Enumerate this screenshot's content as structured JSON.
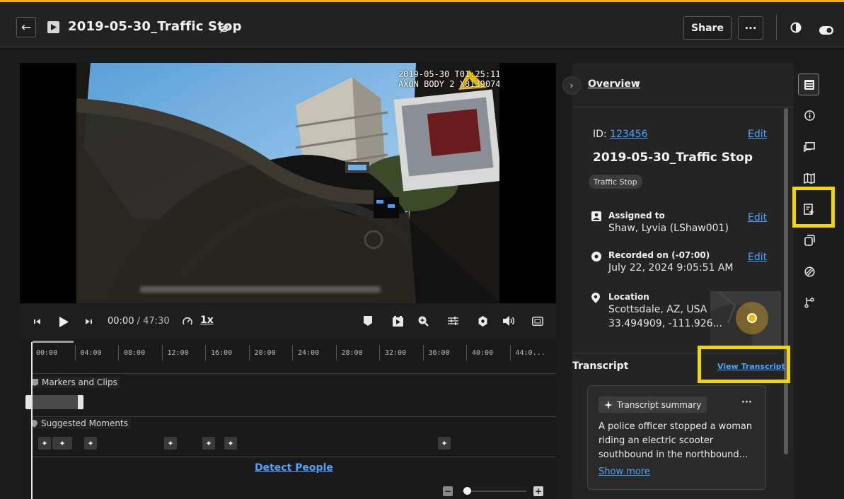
{
  "header": {
    "back_label": "←",
    "title": "2019-05-30_Traffic Stop",
    "share_label": "Share",
    "more_label": "···",
    "icons": [
      "back-arrow-icon",
      "video-icon",
      "eye-off-icon",
      "contrast-icon",
      "toggle-icon"
    ]
  },
  "video": {
    "overlay_line1": "2019-05-30 T01:25:11Z",
    "overlay_line2": "AXON BODY 2 X81390745"
  },
  "controls": {
    "current_time": "00:00",
    "separator": "/",
    "total_time": "47:30",
    "speed": "1x",
    "icons": [
      "prev-frame-icon",
      "play-icon",
      "next-frame-icon",
      "speed-gauge-icon",
      "marker-icon",
      "clip-icon",
      "zoom-in-icon",
      "adjust-icon",
      "settings-icon",
      "volume-icon",
      "fullscreen-icon"
    ]
  },
  "timeline": {
    "ticks": [
      "00:00",
      "04:00",
      "08:00",
      "12:00",
      "16:00",
      "20:00",
      "24:00",
      "28:00",
      "32:00",
      "36:00",
      "40:00",
      "44:0..."
    ],
    "markers_label": "Markers and Clips",
    "moments_label": "Suggested Moments",
    "moment_glyph": "✦",
    "detect_label": "Detect People",
    "zoom_minus": "−",
    "zoom_plus": "+"
  },
  "panel": {
    "collapse_label": "›",
    "overview_label": "Overview",
    "overview_caret": "▾",
    "id_prefix": "ID: ",
    "id_value": "123456",
    "edit_label": "Edit",
    "record_title": "2019-05-30_Traffic Stop",
    "category_chip": "Traffic Stop",
    "assigned_label": "Assigned to",
    "assigned_value": "Shaw, Lyvia (LShaw001)",
    "recorded_label": "Recorded on (-07:00)",
    "recorded_value": "July 22, 2024 9:05:51 AM",
    "location_label": "Location",
    "location_line1": "Scottsdale, AZ, USA",
    "location_line2": "33.494909, -111.926...",
    "transcript_label": "Transcript",
    "view_transcript_label": "View Transcript",
    "summary_chip": "Transcript summary",
    "summary_more": "···",
    "summary_text": "A police officer stopped a woman riding an electric scooter southbound in the northbound...",
    "show_more_label": "Show more"
  },
  "rail": {
    "icons": [
      "overview-icon",
      "info-icon",
      "comments-icon",
      "map-icon",
      "transcript-icon",
      "copy-icon",
      "redact-icon",
      "workflow-icon"
    ]
  },
  "colors": {
    "accent_gold": "#f0b400",
    "highlight_yellow": "#f2d600",
    "link_blue": "#4ea3ff"
  }
}
